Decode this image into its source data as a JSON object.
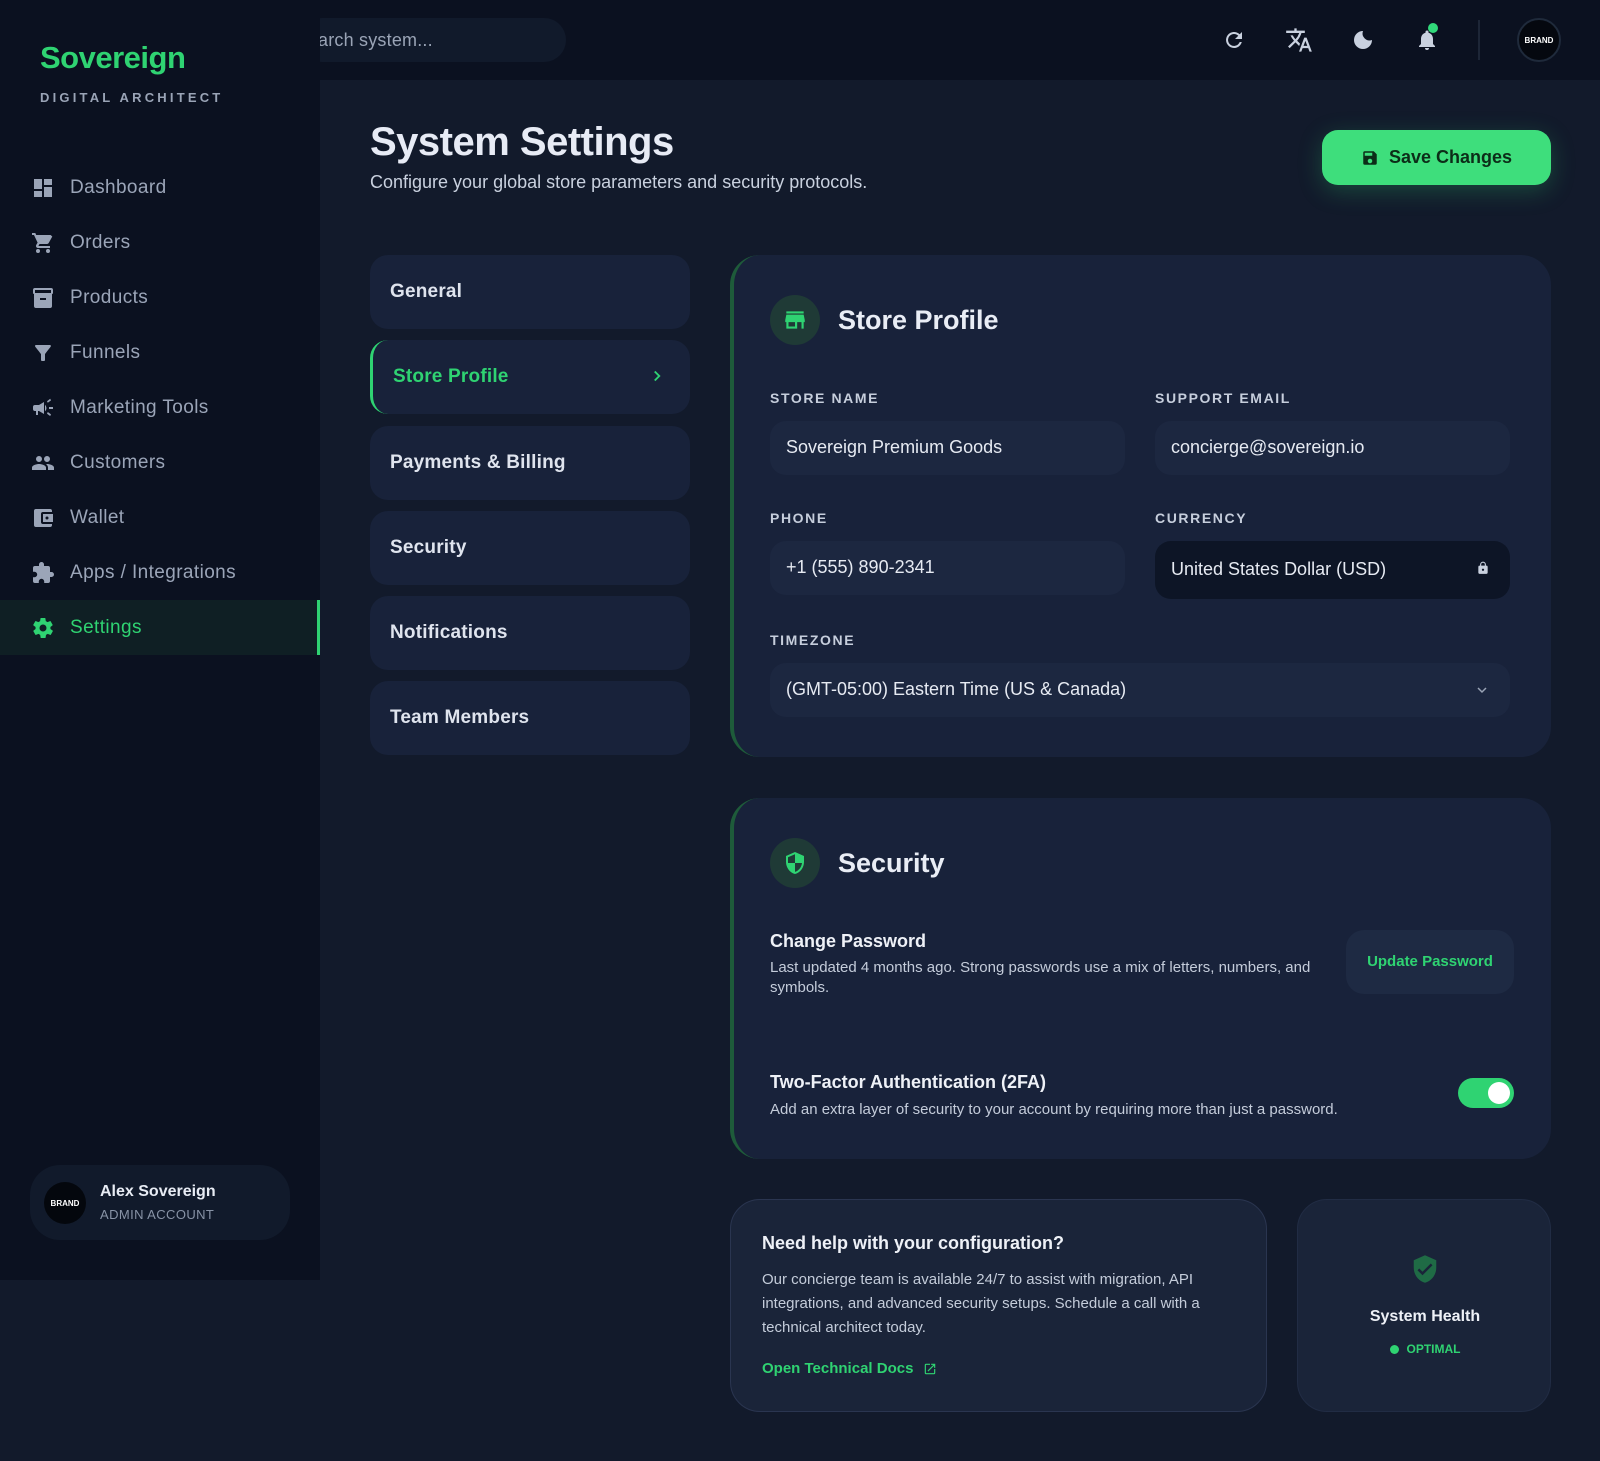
{
  "brand": {
    "name": "Sovereign",
    "tagline": "DIGITAL ARCHITECT"
  },
  "topbar": {
    "search_placeholder": "Search system...",
    "search_visible_text": "arch system...",
    "avatar_text": "BRAND"
  },
  "sidebar": {
    "items": [
      {
        "label": "Dashboard",
        "icon": "dashboard-icon"
      },
      {
        "label": "Orders",
        "icon": "cart-icon"
      },
      {
        "label": "Products",
        "icon": "archive-icon"
      },
      {
        "label": "Funnels",
        "icon": "funnel-icon"
      },
      {
        "label": "Marketing Tools",
        "icon": "megaphone-icon"
      },
      {
        "label": "Customers",
        "icon": "users-icon"
      },
      {
        "label": "Wallet",
        "icon": "wallet-icon"
      },
      {
        "label": "Apps / Integrations",
        "icon": "puzzle-icon"
      },
      {
        "label": "Settings",
        "icon": "gear-icon",
        "active": true
      }
    ]
  },
  "user": {
    "avatar_text": "BRAND",
    "name": "Alex Sovereign",
    "role": "ADMIN ACCOUNT"
  },
  "header": {
    "title": "System Settings",
    "subtitle": "Configure your global store parameters and security protocols.",
    "save_label": "Save Changes"
  },
  "tabs": [
    {
      "label": "General"
    },
    {
      "label": "Store Profile",
      "active": true
    },
    {
      "label": "Payments & Billing"
    },
    {
      "label": "Security"
    },
    {
      "label": "Notifications"
    },
    {
      "label": "Team Members"
    }
  ],
  "store_profile": {
    "title": "Store Profile",
    "store_name_label": "STORE NAME",
    "store_name_value": "Sovereign Premium Goods",
    "support_email_label": "SUPPORT EMAIL",
    "support_email_value": "concierge@sovereign.io",
    "phone_label": "PHONE",
    "phone_value": "+1 (555) 890-2341",
    "currency_label": "CURRENCY",
    "currency_value": "United States Dollar (USD)",
    "timezone_label": "TIMEZONE",
    "timezone_value": "(GMT-05:00) Eastern Time (US & Canada)"
  },
  "security": {
    "title": "Security",
    "password_title": "Change Password",
    "password_desc": "Last updated 4 months ago. Strong passwords use a mix of letters, numbers, and symbols.",
    "update_label": "Update Password",
    "twofa_title": "Two-Factor Authentication (2FA)",
    "twofa_desc": "Add an extra layer of security to your account by requiring more than just a password.",
    "twofa_enabled": true
  },
  "help": {
    "title": "Need help with your configuration?",
    "text": "Our concierge team is available 24/7 to assist with migration, API integrations, and advanced security setups. Schedule a call with a technical architect today.",
    "link": "Open Technical Docs"
  },
  "health": {
    "title": "System Health",
    "status": "OPTIMAL"
  },
  "colors": {
    "accent": "#2fd372",
    "background": "#121a2b",
    "sidebar": "#0b1120",
    "card": "#18223a"
  }
}
